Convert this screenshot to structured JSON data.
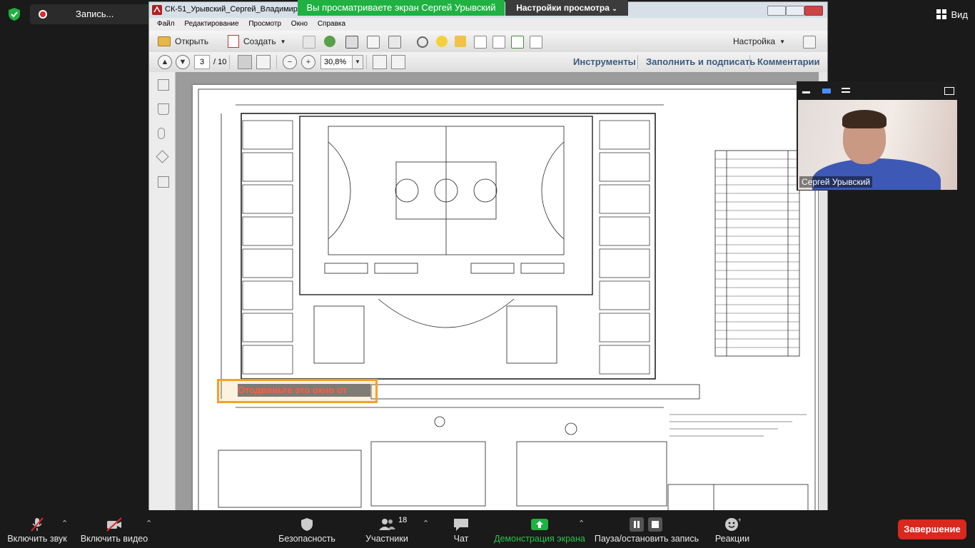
{
  "zoom_top": {
    "recording_label": "Запись...",
    "view_label": "Вид",
    "share_banner": "Вы просматриваете экран Сергей Урывский",
    "view_settings": "Настройки просмотра"
  },
  "acrobat": {
    "title": "СК-51_Урывский_Сергей_Владимирович.pd",
    "menu": [
      "Файл",
      "Редактирование",
      "Просмотр",
      "Окно",
      "Справка"
    ],
    "open_label": "Открыть",
    "create_label": "Создать",
    "customize_label": "Настройка",
    "current_page": "3",
    "page_total": "/ 10",
    "zoom_value": "30,8%",
    "panels": [
      "Инструменты",
      "Заполнить и подписать",
      "Комментарии"
    ]
  },
  "overlay": {
    "message": "Отодвиньте это окно от"
  },
  "video": {
    "participant_name": "Сергей Урывский"
  },
  "zoom_bottom": {
    "mute_label": "Включить звук",
    "video_label": "Включить видео",
    "security_label": "Безопасность",
    "participants_label": "Участники",
    "participants_count": "18",
    "chat_label": "Чат",
    "share_label": "Демонстрация экрана",
    "record_label": "Пауза/остановить запись",
    "reactions_label": "Реакции",
    "end_label": "Завершение"
  },
  "colors": {
    "zoom_green": "#1fb142",
    "end_red": "#d9281e",
    "overlay_border": "#f4a12c"
  }
}
